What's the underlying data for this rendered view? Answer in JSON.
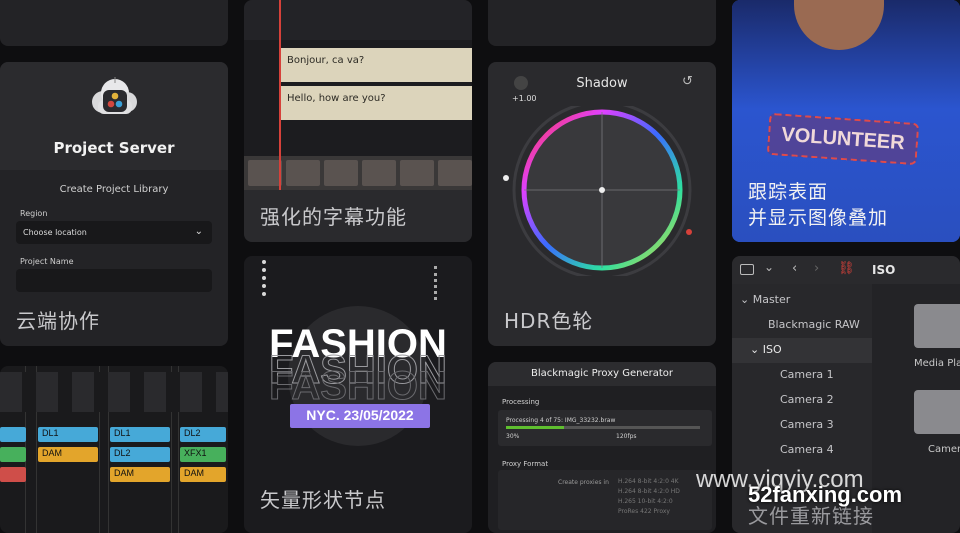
{
  "project_server": {
    "title": "Project Server",
    "form_title": "Create Project Library",
    "region_label": "Region",
    "region_value": "Choose location",
    "name_label": "Project Name",
    "name_value": "",
    "caption": "云端协作"
  },
  "subtitles": {
    "line1": "Bonjour, ca va?",
    "line2": "Hello, how are you?",
    "caption": "强化的字幕功能"
  },
  "hdr": {
    "wheel_title": "Shadow",
    "value": "+1.00",
    "caption": "HDR色轮"
  },
  "fashion": {
    "word": "FASHION",
    "badge": "NYC. 23/05/2022",
    "caption": "矢量形状节点"
  },
  "volunteer": {
    "shirt_text": "VOLUNTEER",
    "caption_line1": "跟踪表面",
    "caption_line2": "并显示图像叠加"
  },
  "proxy": {
    "title": "Blackmagic Proxy Generator",
    "processing_label": "Processing",
    "status": "Processing 4 of 75: IMG_33232.braw",
    "percent": "30%",
    "progress": 0.3,
    "fps": "120fps",
    "format_label": "Proxy Format",
    "create_label": "Create proxies in",
    "options": [
      "H.264 8-bit 4:2:0 4K",
      "H.264 8-bit 4:2:0 HD",
      "H.265 10-bit 4:2:0",
      "ProRes 422 Proxy"
    ]
  },
  "files": {
    "search": "ISO",
    "tree": [
      "Master",
      "Blackmagic RAW",
      "ISO",
      "Camera 1",
      "Camera 2",
      "Camera 3",
      "Camera 4"
    ],
    "folders": [
      "Media Pla",
      "Camer"
    ],
    "caption": "文件重新链接"
  },
  "mixer": {
    "tags": [
      {
        "label": "DL1",
        "color": "blue"
      },
      {
        "label": "DL1",
        "color": "blue"
      },
      {
        "label": "DL2",
        "color": "blue"
      },
      {
        "label": "DAM",
        "color": "yellow"
      },
      {
        "label": "DL2",
        "color": "blue"
      },
      {
        "label": "XFX1",
        "color": "green"
      },
      {
        "label": "DAM",
        "color": "yellow"
      },
      {
        "label": "DAM",
        "color": "yellow"
      }
    ]
  },
  "watermark": {
    "line1": "www.yiqyiy.com",
    "line2": "52fanxing.com"
  },
  "colors": {
    "accent_purple": "#8c74e6",
    "progress_green": "#5fbf2f",
    "timeline_red": "#d6413a",
    "subtitle_bg": "#dcd4bb"
  }
}
